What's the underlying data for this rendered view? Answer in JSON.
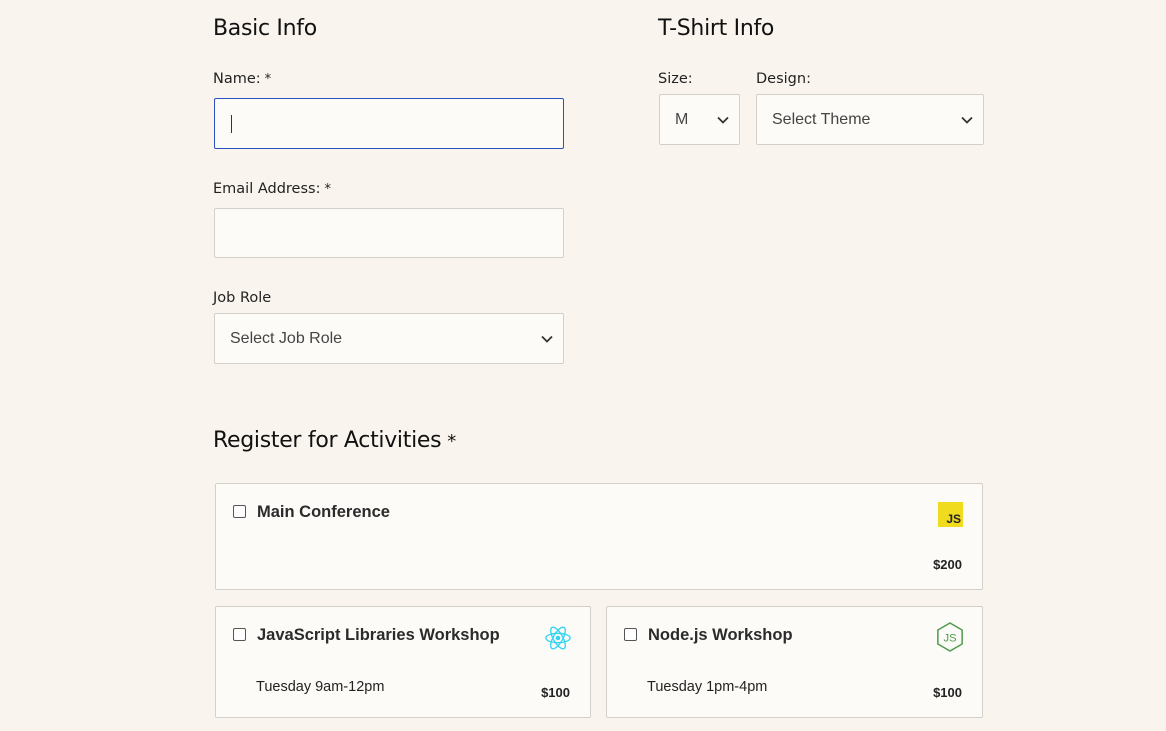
{
  "basic_info": {
    "heading": "Basic Info",
    "name_label": "Name:",
    "name_value": "",
    "email_label": "Email Address:",
    "email_value": "",
    "job_role_label": "Job Role",
    "job_role_selected": "Select Job Role",
    "required_marker": "*"
  },
  "tshirt_info": {
    "heading": "T-Shirt Info",
    "size_label": "Size:",
    "size_selected": "M",
    "design_label": "Design:",
    "design_selected": "Select Theme"
  },
  "activities": {
    "heading": "Register for Activities",
    "required_marker": "*",
    "items": [
      {
        "title": "Main Conference",
        "time": "",
        "price": "$200",
        "icon": "javascript-icon",
        "checked": false
      },
      {
        "title": "JavaScript Libraries Workshop",
        "time": "Tuesday 9am-12pm",
        "price": "$100",
        "icon": "react-icon",
        "checked": false
      },
      {
        "title": "Node.js Workshop",
        "time": "Tuesday 1pm-4pm",
        "price": "$100",
        "icon": "nodejs-icon",
        "checked": false
      }
    ]
  },
  "colors": {
    "background": "#f9f5ee",
    "focus_border": "#2a52be",
    "js_yellow": "#f0db1e",
    "react_cyan": "#2fd4f0",
    "node_green": "#4e9a4a"
  }
}
